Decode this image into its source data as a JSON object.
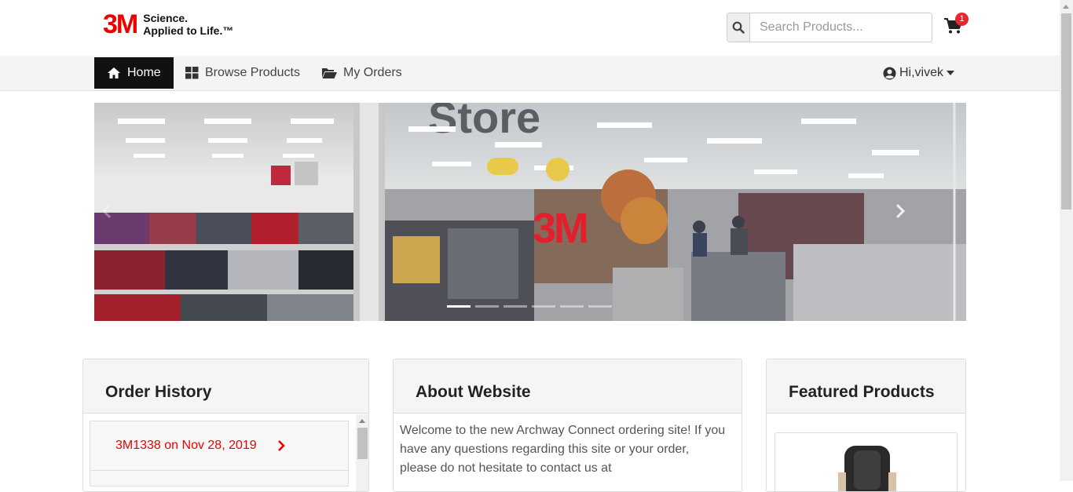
{
  "brand": {
    "logo_mark": "3M",
    "tagline_line1": "Science.",
    "tagline_line2": "Applied to Life.™",
    "accent_color": "#ee0000"
  },
  "search": {
    "placeholder": "Search Products...",
    "value": "",
    "icon": "search-icon"
  },
  "cart": {
    "icon": "shopping-cart-icon",
    "count": "1"
  },
  "nav": {
    "home_label": "Home",
    "browse_label": "Browse Products",
    "orders_label": "My Orders",
    "user_label": "Hi,vivek"
  },
  "carousel": {
    "slide_count": 6,
    "active_index": 0,
    "image_lettering": "3M Store"
  },
  "order_history": {
    "title": "Order History",
    "items": [
      {
        "label": "3M1338 on Nov 28, 2019"
      }
    ]
  },
  "about": {
    "title": "About Website",
    "text": "Welcome to the new Archway Connect ordering site! If you have any questions regarding this site or your order, please do not hesitate to contact us at"
  },
  "featured": {
    "title": "Featured Products"
  }
}
